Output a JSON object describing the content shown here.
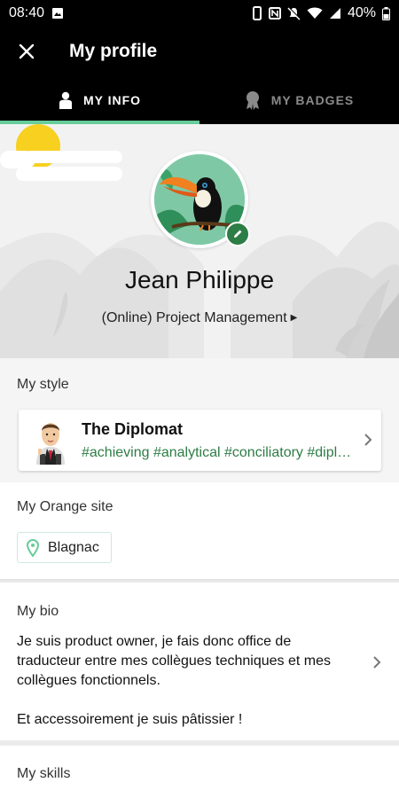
{
  "status_bar": {
    "time": "08:40",
    "battery": "40%"
  },
  "app_bar": {
    "title": "My profile"
  },
  "tabs": [
    {
      "label": "MY INFO",
      "active": true,
      "icon": "person-icon"
    },
    {
      "label": "MY BADGES",
      "active": false,
      "icon": "badge-icon"
    }
  ],
  "profile": {
    "name": "Jean Philippe",
    "department": "(Online) Project Management",
    "avatar": "toucan-avatar"
  },
  "my_style": {
    "title": "My style",
    "name": "The Diplomat",
    "tags": "#achieving #analytical #conciliatory #diplomatic"
  },
  "my_site": {
    "title": "My Orange site",
    "location": "Blagnac"
  },
  "my_bio": {
    "title": "My bio",
    "text": "Je suis product owner, je fais donc office de traducteur entre mes collègues techniques et mes collègues fonctionnels.\n\nEt accessoirement je suis pâtissier !"
  },
  "my_skills": {
    "title": "My skills"
  },
  "colors": {
    "accent": "#66cc99",
    "accent_dark": "#2d7d46",
    "header": "#000000"
  }
}
